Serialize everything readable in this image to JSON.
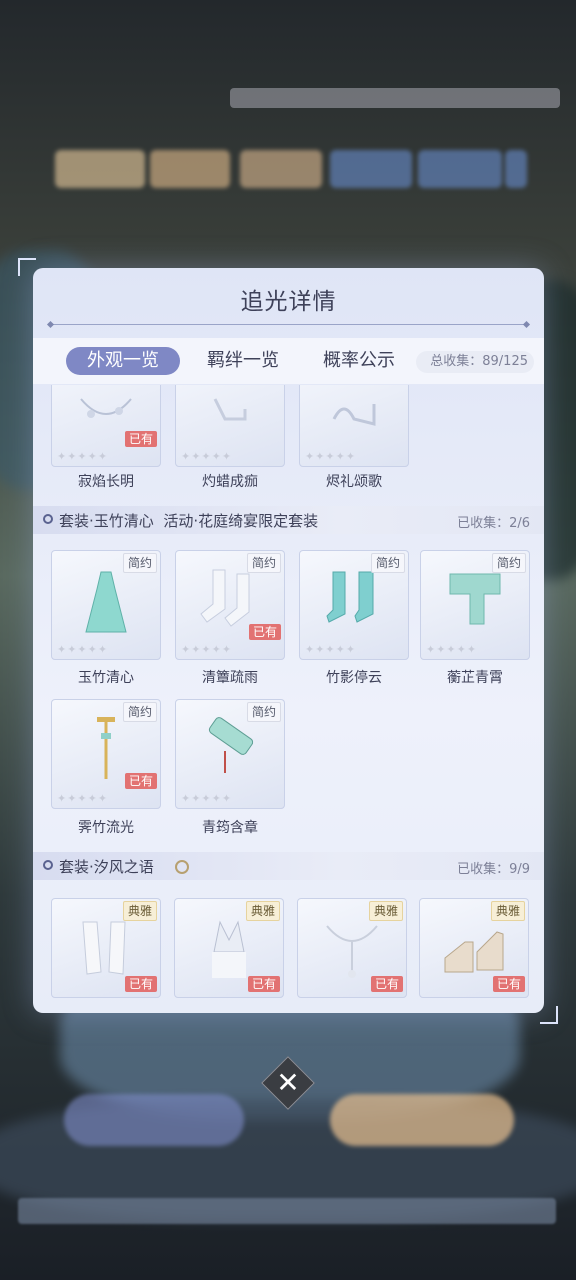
{
  "modal": {
    "title": "追光详情"
  },
  "tabs": [
    {
      "label": "外观一览",
      "active": true
    },
    {
      "label": "羁绊一览",
      "active": false
    },
    {
      "label": "概率公示",
      "active": false
    }
  ],
  "total_collection": "总收集：89/125",
  "top_row": [
    {
      "name": "寂焰长明",
      "owned": "已有",
      "icon": "jewelry-icon"
    },
    {
      "name": "灼蜡成痂",
      "icon": "shoes-icon"
    },
    {
      "name": "烬礼颂歌",
      "icon": "heels-icon"
    }
  ],
  "sections": [
    {
      "title": "套装·玉竹清心",
      "subtitle": "活动·花庭绮宴限定套装",
      "count": "已收集：2/6",
      "items": [
        {
          "name": "玉竹清心",
          "tag": "简约",
          "icon": "dress-icon"
        },
        {
          "name": "清簟疏雨",
          "tag": "简约",
          "owned": "已有",
          "icon": "socks-icon"
        },
        {
          "name": "竹影停云",
          "tag": "简约",
          "icon": "boots-icon"
        },
        {
          "name": "蘅芷青霄",
          "tag": "简约",
          "icon": "scarf-icon"
        },
        {
          "name": "霁竹流光",
          "tag": "简约",
          "owned": "已有",
          "icon": "hairpin-icon"
        },
        {
          "name": "青筠含章",
          "tag": "简约",
          "icon": "scroll-icon"
        }
      ]
    },
    {
      "title": "套装·汐风之语",
      "count": "已收集：9/9",
      "items": [
        {
          "tag": "典雅",
          "owned": "已有",
          "icon": "gloves-icon"
        },
        {
          "tag": "典雅",
          "owned": "已有",
          "icon": "crown-icon"
        },
        {
          "tag": "典雅",
          "owned": "已有",
          "icon": "necklace-icon"
        },
        {
          "tag": "典雅",
          "owned": "已有",
          "icon": "high-heels-icon"
        }
      ]
    }
  ],
  "stars": "✦✦✦✦✦",
  "close_symbol": "✕"
}
